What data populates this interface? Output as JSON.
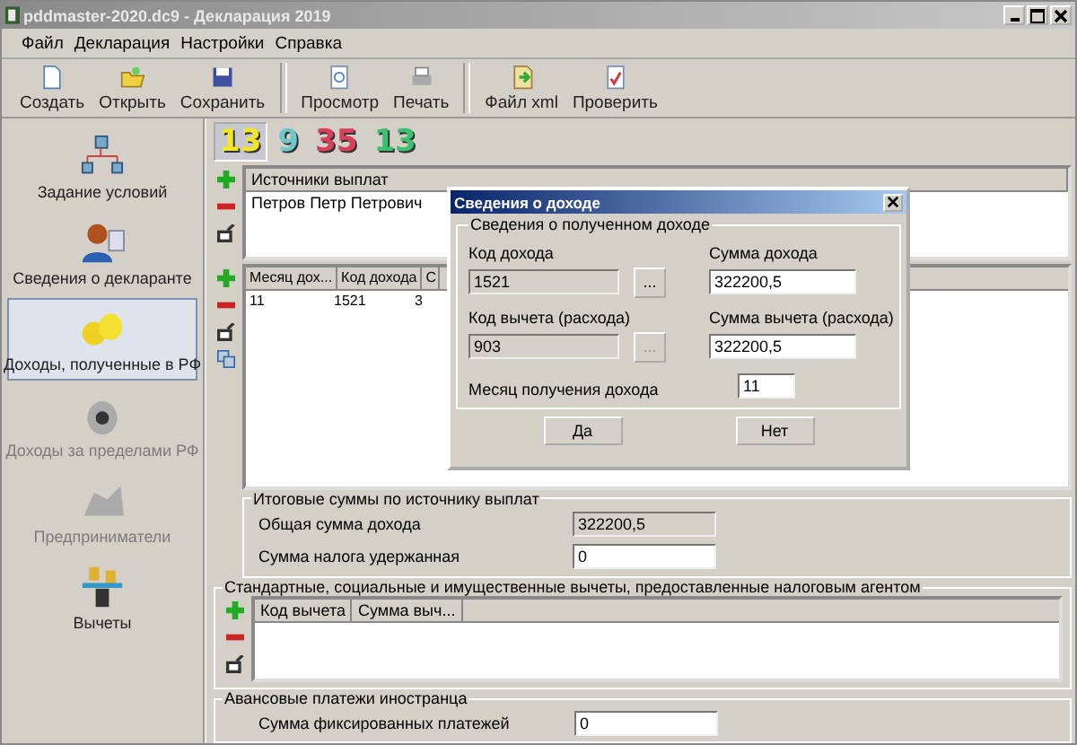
{
  "window": {
    "title": "pddmaster-2020.dc9 - Декларация 2019"
  },
  "menu": [
    "Файл",
    "Декларация",
    "Настройки",
    "Справка"
  ],
  "toolbar": [
    [
      "Создать",
      "Открыть",
      "Сохранить"
    ],
    [
      "Просмотр",
      "Печать"
    ],
    [
      "Файл xml",
      "Проверить"
    ]
  ],
  "sidebar": {
    "items": [
      {
        "label": "Задание условий",
        "selected": false,
        "disabled": false
      },
      {
        "label": "Сведения о декларанте",
        "selected": false,
        "disabled": false
      },
      {
        "label": "Доходы, полученные в РФ",
        "selected": true,
        "disabled": false
      },
      {
        "label": "Доходы за пределами РФ",
        "selected": false,
        "disabled": true
      },
      {
        "label": "Предприниматели",
        "selected": false,
        "disabled": true
      },
      {
        "label": "Вычеты",
        "selected": false,
        "disabled": false
      }
    ]
  },
  "rates": [
    {
      "label": "13",
      "color": "#f2e52a",
      "selected": true
    },
    {
      "label": "9",
      "color": "#6cc9c9",
      "selected": false
    },
    {
      "label": "35",
      "color": "#d8405a",
      "selected": false
    },
    {
      "label": "13",
      "color": "#3cc070",
      "selected": false
    }
  ],
  "sources": {
    "column": "Источники выплат",
    "rows": [
      "Петров Петр Петрович"
    ]
  },
  "incomes": {
    "columns": [
      "Месяц дох...",
      "Код дохода",
      "С"
    ],
    "rows": [
      [
        "11",
        "1521",
        "3"
      ]
    ]
  },
  "totals": {
    "title": "Итоговые суммы по источнику выплат",
    "fields": [
      {
        "label": "Общая сумма дохода",
        "value": "322200,5",
        "disabled": true
      },
      {
        "label": "Сумма налога удержанная",
        "value": "0",
        "disabled": false
      }
    ]
  },
  "deductions": {
    "title": "Стандартные, социальные и имущественные вычеты, предоставленные налоговым агентом",
    "columns": [
      "Код вычета",
      "Сумма выч..."
    ]
  },
  "advance": {
    "title": "Авансовые платежи иностранца",
    "fields": [
      {
        "label": "Сумма фиксированных платежей",
        "value": "0",
        "disabled": false
      }
    ]
  },
  "dialog": {
    "title": "Сведения о доходе",
    "group": "Сведения о полученном доходе",
    "left": [
      {
        "label": "Код дохода",
        "value": "1521",
        "disabled": true,
        "button": "...",
        "button_disabled": false
      },
      {
        "label": "Код вычета (расхода)",
        "value": "903",
        "disabled": true,
        "button": "...",
        "button_disabled": true
      }
    ],
    "right": [
      {
        "label": "Сумма дохода",
        "value": "322200,5",
        "disabled": false
      },
      {
        "label": "Сумма вычета (расхода)",
        "value": "322200,5",
        "disabled": false
      }
    ],
    "month": {
      "label": "Месяц получения дохода",
      "value": "11",
      "disabled": false
    },
    "buttons": [
      "Да",
      "Нет"
    ]
  }
}
